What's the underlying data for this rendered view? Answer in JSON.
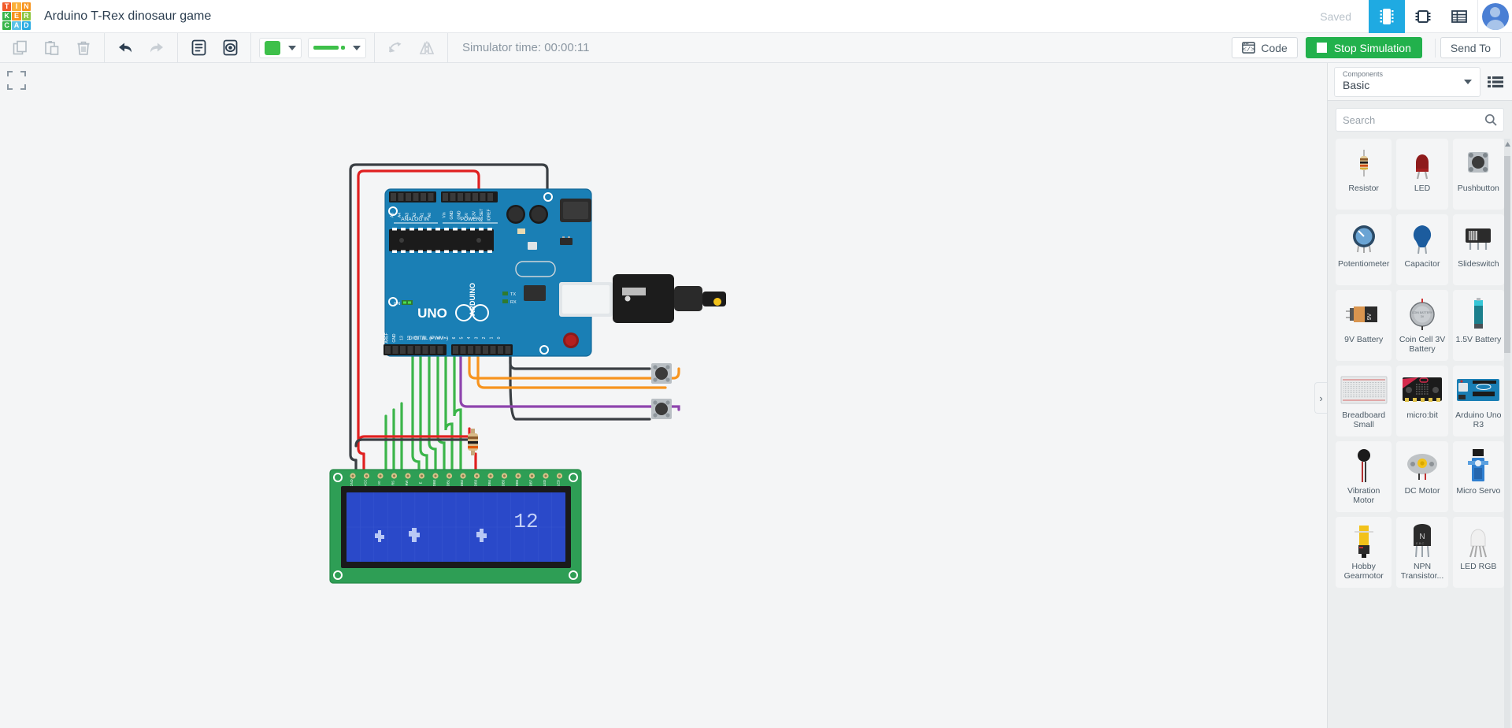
{
  "app": {
    "logo_tiles": [
      {
        "letter": "T",
        "color": "#f15a29"
      },
      {
        "letter": "I",
        "color": "#fbb03b"
      },
      {
        "letter": "N",
        "color": "#f7941e"
      },
      {
        "letter": "K",
        "color": "#39b54a"
      },
      {
        "letter": "E",
        "color": "#f7941e"
      },
      {
        "letter": "R",
        "color": "#8cc63f"
      },
      {
        "letter": "C",
        "color": "#39b54a"
      },
      {
        "letter": "A",
        "color": "#5bc2e7"
      },
      {
        "letter": "D",
        "color": "#29abe2"
      }
    ],
    "title": "Arduino T-Rex dinosaur game",
    "save_status": "Saved"
  },
  "topbar_icons": [
    {
      "name": "circuits-view-icon",
      "label": "Circuits",
      "active": true
    },
    {
      "name": "chip-view-icon",
      "label": "Components",
      "active": false
    },
    {
      "name": "list-view-icon",
      "label": "List view",
      "active": false
    }
  ],
  "toolbar": {
    "copy_label": "Copy",
    "paste_label": "Paste",
    "delete_label": "Delete",
    "undo_label": "Undo",
    "redo_label": "Redo",
    "notes_label": "Notes",
    "visibility_label": "Show/Hide",
    "rotate_label": "Rotate",
    "mirror_label": "Mirror",
    "color_value": "#3ec04a",
    "wire_color": "#3ec04a",
    "sim_time_text": "Simulator time: 00:00:11",
    "code_label": "Code",
    "stop_label": "Stop Simulation",
    "send_to_label": "Send To",
    "stop_button_color": "#22b14c"
  },
  "canvas": {
    "fit_view_label": "Fit view",
    "panel_toggle_label": "›",
    "lcd": {
      "line1": "12",
      "pins": [
        "GND",
        "VCC",
        "V0",
        "RS",
        "RW",
        "E",
        "DB0",
        "DB1",
        "DB2",
        "DB3",
        "DB4",
        "DB5",
        "DB6",
        "DB7",
        "LED",
        "LED"
      ],
      "screen_color": "#2a49c9",
      "text_color": "#b9c8f5"
    },
    "arduino": {
      "silk_title": "ARDUINO",
      "model": "UNO",
      "analog_header": "ANALOG IN",
      "power_header": "POWER",
      "digital_header": "DIGITAL (PWM~)",
      "analog_pins": [
        "A5",
        "A4",
        "A3",
        "A2",
        "A1",
        "A0"
      ],
      "power_pins": [
        "Vin",
        "GND",
        "GND",
        "5V",
        "3.3V",
        "RESET",
        "IOREF"
      ],
      "digital_pins": [
        "AREF",
        "GND",
        "13",
        "12",
        "11",
        "10",
        "9",
        "8",
        "7",
        "6",
        "5",
        "4",
        "3",
        "2",
        "1",
        "0"
      ],
      "leds": [
        "ON",
        "TX",
        "RX",
        "L"
      ]
    },
    "wire_colors": {
      "power_red": "#e02020",
      "ground_black": "#3a3f44",
      "data_green": "#3bb54a",
      "signal_orange": "#f7941e",
      "signal_purple": "#8e44ad"
    }
  },
  "panel": {
    "components_label": "Components",
    "selected_category": "Basic",
    "list_view_label": "List view",
    "search": {
      "placeholder": "Search",
      "value": ""
    },
    "components": [
      {
        "name": "Resistor",
        "icon": "resistor-icon"
      },
      {
        "name": "LED",
        "icon": "led-icon"
      },
      {
        "name": "Pushbutton",
        "icon": "pushbutton-icon"
      },
      {
        "name": "Potentiometer",
        "icon": "potentiometer-icon"
      },
      {
        "name": "Capacitor",
        "icon": "capacitor-icon"
      },
      {
        "name": "Slideswitch",
        "icon": "slideswitch-icon"
      },
      {
        "name": "9V Battery",
        "icon": "battery-9v-icon"
      },
      {
        "name": "Coin Cell 3V Battery",
        "icon": "coin-cell-icon"
      },
      {
        "name": "1.5V Battery",
        "icon": "battery-aa-icon"
      },
      {
        "name": "Breadboard Small",
        "icon": "breadboard-icon"
      },
      {
        "name": "micro:bit",
        "icon": "microbit-icon"
      },
      {
        "name": "Arduino Uno R3",
        "icon": "arduino-icon"
      },
      {
        "name": "Vibration Motor",
        "icon": "vibration-motor-icon"
      },
      {
        "name": "DC Motor",
        "icon": "dc-motor-icon"
      },
      {
        "name": "Micro Servo",
        "icon": "servo-icon"
      },
      {
        "name": "Hobby Gearmotor",
        "icon": "gearmotor-icon"
      },
      {
        "name": "NPN Transistor...",
        "icon": "npn-transistor-icon"
      },
      {
        "name": "LED RGB",
        "icon": "led-rgb-icon"
      }
    ]
  }
}
